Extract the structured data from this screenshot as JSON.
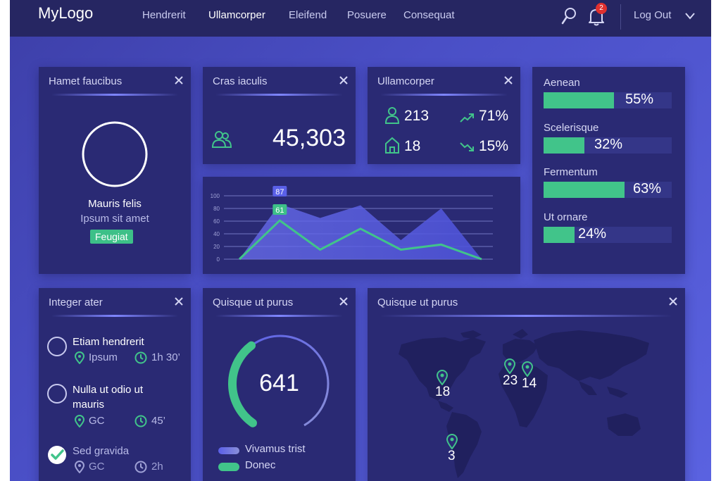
{
  "header": {
    "logo": "MyLogo",
    "nav": [
      "Hendrerit",
      "Ullamcorper",
      "Eleifend",
      "Posuere",
      "Consequat"
    ],
    "active_nav": "Ullamcorper",
    "notification_count": "2",
    "logout": "Log Out"
  },
  "profile_card": {
    "title": "Hamet faucibus",
    "name": "Mauris felis",
    "subtitle": "Ipsum sit amet",
    "tag": "Feugiat"
  },
  "stat_card": {
    "title": "Cras iaculis",
    "value": "45,303"
  },
  "mini_stats": {
    "title": "Ullamcorper",
    "users": "213",
    "homes": "18",
    "up_pct": "71%",
    "down_pct": "15%"
  },
  "chart_data": {
    "type": "area",
    "y_ticks": [
      "100",
      "80",
      "60",
      "40",
      "20",
      "0"
    ],
    "ylim": [
      0,
      100
    ],
    "grid": true,
    "series": [
      {
        "values": [
          0,
          87,
          65,
          85,
          30,
          80,
          0
        ]
      },
      {
        "values": [
          0,
          61,
          15,
          48,
          15,
          23,
          0
        ]
      }
    ],
    "labels": [
      "87",
      "61"
    ]
  },
  "progress_card": {
    "items": [
      {
        "label": "Aenean",
        "value": 55,
        "pct": "55%"
      },
      {
        "label": "Scelerisque",
        "value": 32,
        "pct": "32%"
      },
      {
        "label": "Fermentum",
        "value": 63,
        "pct": "63%"
      },
      {
        "label": "Ut ornare",
        "value": 24,
        "pct": "24%"
      }
    ]
  },
  "tasks_card": {
    "title": "Integer ater",
    "tasks": [
      {
        "title": "Etiam hendrerit",
        "place": "Ipsum",
        "time": "1h 30’",
        "done": false
      },
      {
        "title": "Nulla ut odio ut",
        "title2": "mauris",
        "place": "GC",
        "time": "45’",
        "done": false
      },
      {
        "title": "Sed gravida",
        "place": "GC",
        "time": "2h",
        "done": true
      }
    ]
  },
  "gauge_card": {
    "title": "Quisque ut purus",
    "value": "641",
    "fill_fraction": 0.36,
    "legend": [
      "Vivamus trist",
      "Donec"
    ]
  },
  "map_card": {
    "title": "Quisque ut purus",
    "pins": [
      "18",
      "23",
      "14",
      "3"
    ]
  },
  "colors": {
    "accent_green": "#41c48a",
    "card_bg": "#2a2a74",
    "topbar": "#262662",
    "badge_red": "#e0302f"
  }
}
